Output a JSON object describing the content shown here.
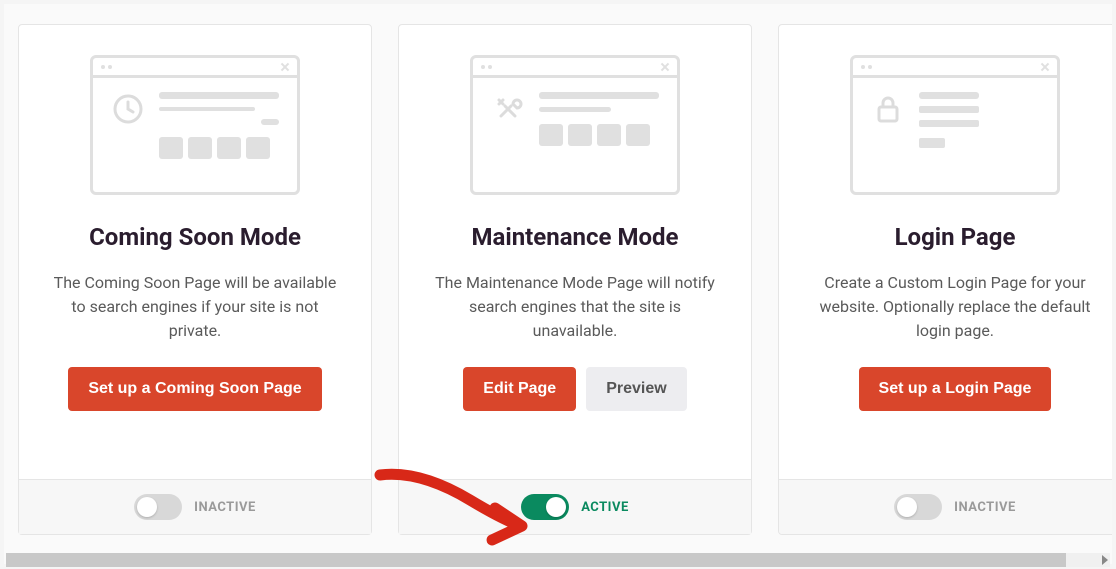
{
  "cards": [
    {
      "title": "Coming Soon Mode",
      "description": "The Coming Soon Page will be available to search engines if your site is not private.",
      "primary_button": "Set up a Coming Soon Page",
      "status_label": "INACTIVE",
      "active": false,
      "icon": "clock-icon"
    },
    {
      "title": "Maintenance Mode",
      "description": "The Maintenance Mode Page will notify search engines that the site is unavailable.",
      "primary_button": "Edit Page",
      "secondary_button": "Preview",
      "status_label": "ACTIVE",
      "active": true,
      "icon": "tools-icon"
    },
    {
      "title": "Login Page",
      "description": "Create a Custom Login Page for your website. Optionally replace the default login page.",
      "primary_button": "Set up a Login Page",
      "status_label": "INACTIVE",
      "active": false,
      "icon": "lock-icon"
    }
  ],
  "colors": {
    "primary": "#d9462b",
    "active": "#0a8a5f",
    "inactive": "#9a9a9a"
  }
}
